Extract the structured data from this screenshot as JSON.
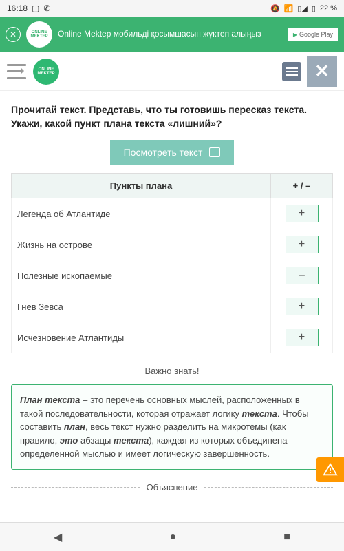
{
  "status": {
    "time": "16:18",
    "battery": "22 %"
  },
  "promo": {
    "text": "Online Mektep мобильді қосымшасын жүктеп алыңыз",
    "logo": "ONLINE MEKTEP",
    "store": "Google Play"
  },
  "header": {
    "logo": "ONLINE MEKTEP"
  },
  "question": "Прочитай текст. Представь, что ты готовишь пересказ текста. Укажи, какой пункт плана текста «лишний»?",
  "viewBtn": "Посмотреть текст",
  "table": {
    "headers": [
      "Пункты плана",
      "+ / –"
    ],
    "rows": [
      {
        "label": "Легенда об Атлантиде",
        "mark": "+"
      },
      {
        "label": "Жизнь на острове",
        "mark": "+"
      },
      {
        "label": "Полезные ископаемые",
        "mark": "–"
      },
      {
        "label": "Гнев Зевса",
        "mark": "+"
      },
      {
        "label": "Исчезновение Атлантиды",
        "mark": "+"
      }
    ]
  },
  "divider1": "Важно знать!",
  "info": {
    "b1": "План текста",
    "t1": " – это перечень основных мыслей, расположенных в такой последовательности, которая отражает логику ",
    "b2": "текста",
    "t2": ". Чтобы составить ",
    "b3": "план",
    "t3": ", весь текст нужно разделить на микротемы (как правило, ",
    "b4": "это",
    "t4": " абзацы ",
    "b5": "текста",
    "t5": "), каждая из которых объединена определенной мыслью и имеет логическую завершенность."
  },
  "divider2": "Объяснение"
}
